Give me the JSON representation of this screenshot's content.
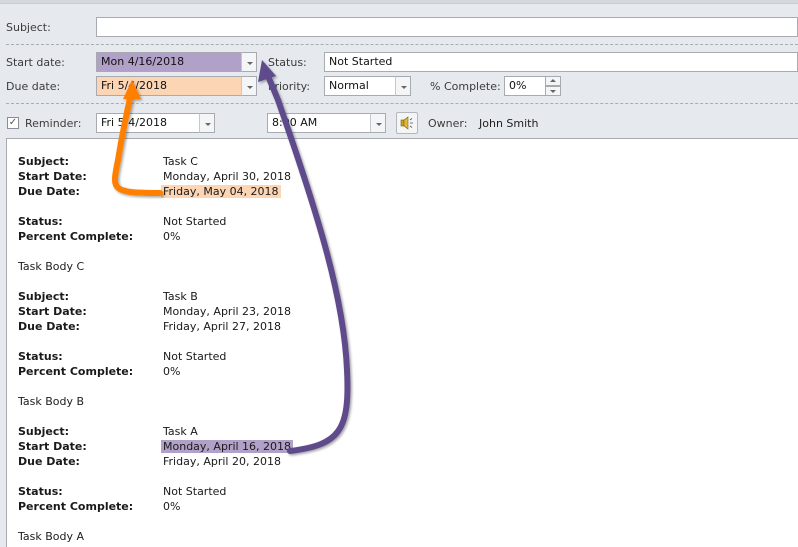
{
  "form": {
    "subject": {
      "label": "Subject:",
      "value": ""
    },
    "start_date": {
      "label": "Start date:",
      "value": "Mon 4/16/2018",
      "highlight": "#b1a0c7"
    },
    "due_date": {
      "label": "Due date:",
      "value": "Fri 5/4/2018",
      "highlight": "#fcd5b4"
    },
    "status": {
      "label": "Status:",
      "value": "Not Started"
    },
    "priority": {
      "label": "Priority:",
      "value": "Normal"
    },
    "percent_complete": {
      "label": "% Complete:",
      "value": "0%"
    },
    "reminder": {
      "label": "Reminder:",
      "checked": true,
      "date": "Fri 5/4/2018",
      "time": "8:00 AM"
    },
    "owner": {
      "label": "Owner:",
      "value": "John Smith"
    }
  },
  "tasks": [
    {
      "subject_label": "Subject:",
      "subject": "Task C",
      "start_label": "Start Date:",
      "start": "Monday, April 30, 2018",
      "due_label": "Due Date:",
      "due": "Friday, May 04, 2018",
      "status_label": "Status:",
      "status": "Not Started",
      "percent_label": "Percent Complete:",
      "percent": "0%",
      "body": "Task Body C"
    },
    {
      "subject_label": "Subject:",
      "subject": "Task B",
      "start_label": "Start Date:",
      "start": "Monday, April 23, 2018",
      "due_label": "Due Date:",
      "due": "Friday, April 27, 2018",
      "status_label": "Status:",
      "status": "Not Started",
      "percent_label": "Percent Complete:",
      "percent": "0%",
      "body": "Task Body B"
    },
    {
      "subject_label": "Subject:",
      "subject": "Task A",
      "start_label": "Start Date:",
      "start": "Monday, April 16, 2018",
      "due_label": "Due Date:",
      "due": "Friday, April 20, 2018",
      "status_label": "Status:",
      "status": "Not Started",
      "percent_label": "Percent Complete:",
      "percent": "0%",
      "body": "Task Body A"
    }
  ],
  "annotations": {
    "orange_arrow_color": "#ff8000",
    "purple_arrow_color": "#5f4b8b"
  }
}
